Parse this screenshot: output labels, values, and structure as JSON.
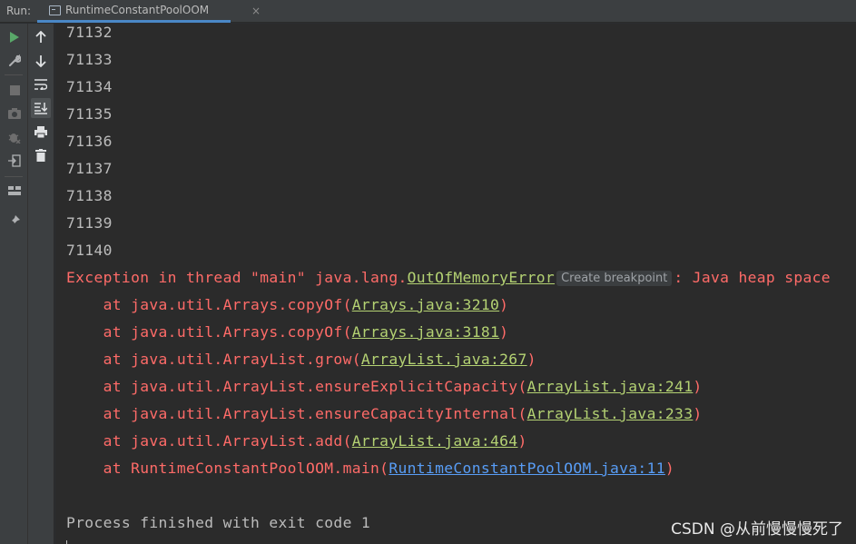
{
  "run_bar": {
    "label": "Run:",
    "tab_label": "RuntimeConstantPoolOOM",
    "close_glyph": "×"
  },
  "toolbar_primary": {
    "items": [
      "run-icon",
      "wrench-icon",
      "stop-icon",
      "camera-icon",
      "debug-bug-icon",
      "login-exit-icon",
      "layout-icon",
      "pin-icon"
    ]
  },
  "toolbar_secondary": {
    "items": [
      "up-arrow-icon",
      "down-arrow-icon",
      "soft-wrap-icon",
      "scroll-to-end-icon",
      "print-icon",
      "trash-icon"
    ]
  },
  "console": {
    "numbers": [
      "71132",
      "71133",
      "71134",
      "71135",
      "71136",
      "71137",
      "71138",
      "71139",
      "71140"
    ],
    "exception": {
      "prefix": "Exception in thread \"main\" java.lang.",
      "class_link": "OutOfMemoryError",
      "hint": "Create breakpoint",
      "suffix": ": Java heap space"
    },
    "stack": [
      {
        "method": "    at java.util.Arrays.copyOf(",
        "link": "Arrays.java:3210",
        "close": ")"
      },
      {
        "method": "    at java.util.Arrays.copyOf(",
        "link": "Arrays.java:3181",
        "close": ")"
      },
      {
        "method": "    at java.util.ArrayList.grow(",
        "link": "ArrayList.java:267",
        "close": ")"
      },
      {
        "method": "    at java.util.ArrayList.ensureExplicitCapacity(",
        "link": "ArrayList.java:241",
        "close": ")"
      },
      {
        "method": "    at java.util.ArrayList.ensureCapacityInternal(",
        "link": "ArrayList.java:233",
        "close": ")"
      },
      {
        "method": "    at java.util.ArrayList.add(",
        "link": "ArrayList.java:464",
        "close": ")"
      },
      {
        "method": "    at RuntimeConstantPoolOOM.main(",
        "link": "RuntimeConstantPoolOOM.java:11",
        "close": ")"
      }
    ],
    "exit_message": "Process finished with exit code 1"
  },
  "watermark": "CSDN @从前慢慢慢死了",
  "colors": {
    "console_bg": "#2b2b2b",
    "panel_bg": "#3c3f41",
    "text": "#bbbbbb",
    "error": "#ff6b68",
    "link": "#b4d273",
    "user_link": "#589df6",
    "run_green": "#59a869",
    "tab_accent": "#4a88c7"
  }
}
